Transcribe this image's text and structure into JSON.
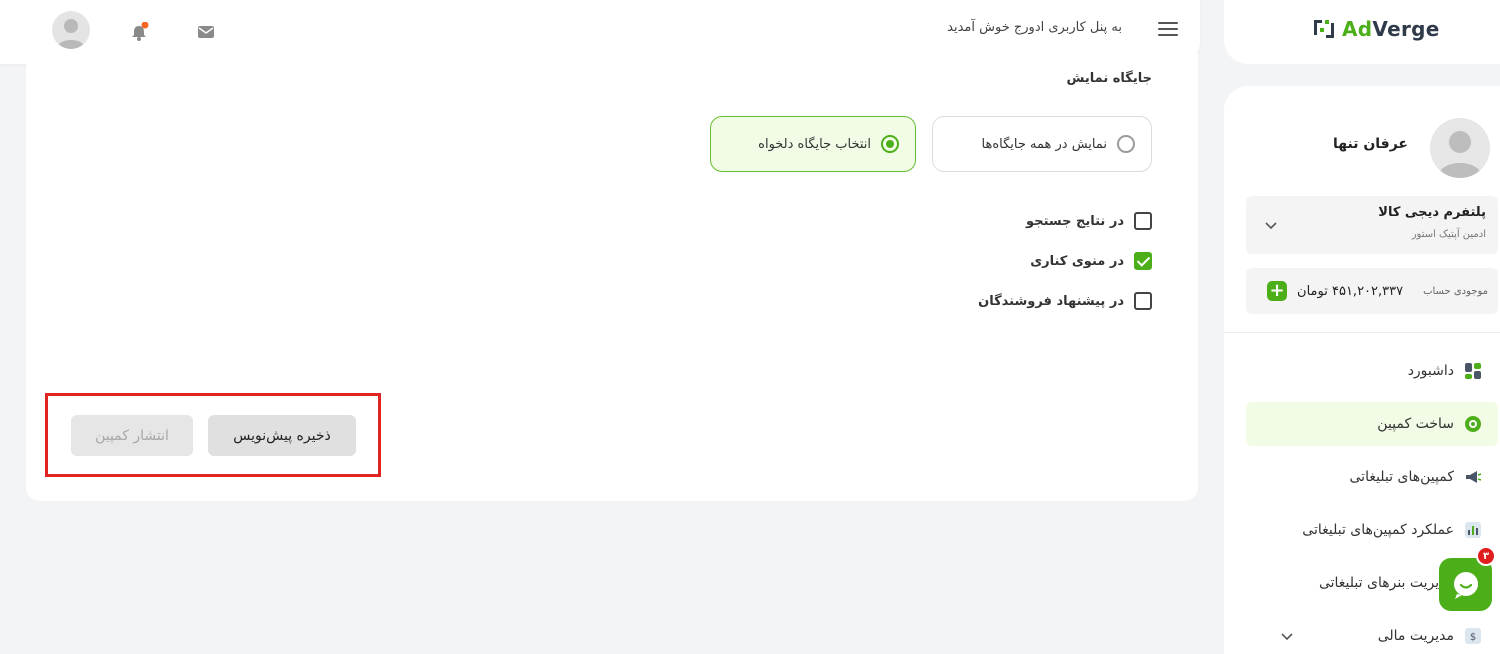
{
  "header": {
    "welcome": "به پنل کاربری ادورج خوش آمدید"
  },
  "logo": {
    "ad": "Ad",
    "verge": "Verge"
  },
  "sidebar": {
    "user_name": "عرفان تنها",
    "platform_name": "پلتفرم دیجی کالا",
    "platform_role": "ادمین آپتیک استور",
    "balance_label": "موجودی حساب",
    "balance_amount": "۴۵۱,۲۰۲,۳۳۷ تومان",
    "nav": [
      {
        "label": "داشبورد",
        "icon": "dashboard-icon"
      },
      {
        "label": "ساخت کمپین",
        "icon": "create-campaign-icon",
        "active": true
      },
      {
        "label": "کمپین‌های تبلیغاتی",
        "icon": "megaphone-icon"
      },
      {
        "label": "عملکرد کمپین‌های تبلیغاتی",
        "icon": "chart-icon"
      },
      {
        "label": "مدیریت بنرهای تبلیغاتی",
        "icon": "banner-icon"
      },
      {
        "label": "مدیریت مالی",
        "icon": "finance-icon"
      }
    ]
  },
  "main": {
    "section_label": "جایگاه نمایش",
    "radio_all": "نمایش در همه جایگاه‌ها",
    "radio_custom": "انتخاب جایگاه دلخواه",
    "checkboxes": [
      {
        "label": "در نتایج جستجو",
        "checked": false
      },
      {
        "label": "در منوی کناری",
        "checked": true
      },
      {
        "label": "در پیشنهاد فروشندگان",
        "checked": false
      }
    ],
    "save_draft": "ذخیره پیش‌نویس",
    "publish": "انتشار کمپین"
  },
  "chat": {
    "badge": "۳"
  },
  "colors": {
    "accent": "#4caf1a",
    "accent_bg": "#f1fbe5",
    "highlight": "#e02424",
    "notification": "#f26522"
  }
}
